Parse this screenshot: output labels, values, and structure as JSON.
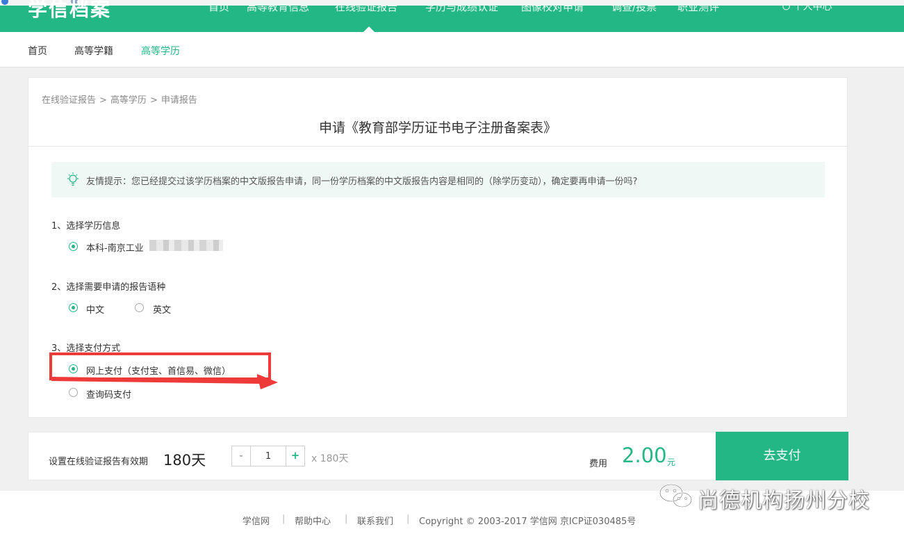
{
  "header": {
    "logo": "学信档案",
    "nav": [
      "首页",
      "高等教育信息",
      "在线验证报告",
      "学历与成绩认证",
      "图像校对申请",
      "调查/投票",
      "职业测评"
    ],
    "user": "个人中心"
  },
  "subnav": {
    "items": [
      "首页",
      "高等学籍",
      "高等学历"
    ],
    "active_index": 2
  },
  "breadcrumb": {
    "items": [
      "在线验证报告",
      "高等学历",
      "申请报告"
    ],
    "separator": ">"
  },
  "page_title": "申请《教育部学历证书电子注册备案表》",
  "tip": {
    "text": "友情提示：您已经提交过该学历档案的中文版报告申请，同一份学历档案的中文版报告内容是相同的（除学历变动），确定要再申请一份吗?"
  },
  "sections": {
    "education": {
      "title": "1、选择学历信息",
      "option": "本科-南京工业"
    },
    "language": {
      "title": "2、选择需要申请的报告语种",
      "options": [
        "中文",
        "英文"
      ],
      "selected": "中文"
    },
    "payment": {
      "title": "3、选择支付方式",
      "options": [
        "网上支付（支付宝、首信易、微信）",
        "查询码支付"
      ],
      "selected": "网上支付（支付宝、首信易、微信）"
    }
  },
  "bottom_bar": {
    "validity_label": "设置在线验证报告有效期",
    "validity_value": "180天",
    "stepper": {
      "minus": "-",
      "value": "1",
      "plus": "+"
    },
    "multiplier": "x 180天",
    "fee_label": "费用",
    "fee_value": "2.00",
    "fee_unit": "元",
    "pay_button": "去支付"
  },
  "footer": {
    "links": [
      "学信网",
      "帮助中心",
      "联系我们"
    ],
    "separator": "|",
    "copyright": "Copyright © 2003-2017 学信网 京ICP证030485号"
  },
  "watermark": {
    "text": "尚德机构扬州分校"
  },
  "colors": {
    "brand": "#23b786",
    "highlight": "#ef3a3a",
    "tip_bg": "#f0f8f5"
  }
}
